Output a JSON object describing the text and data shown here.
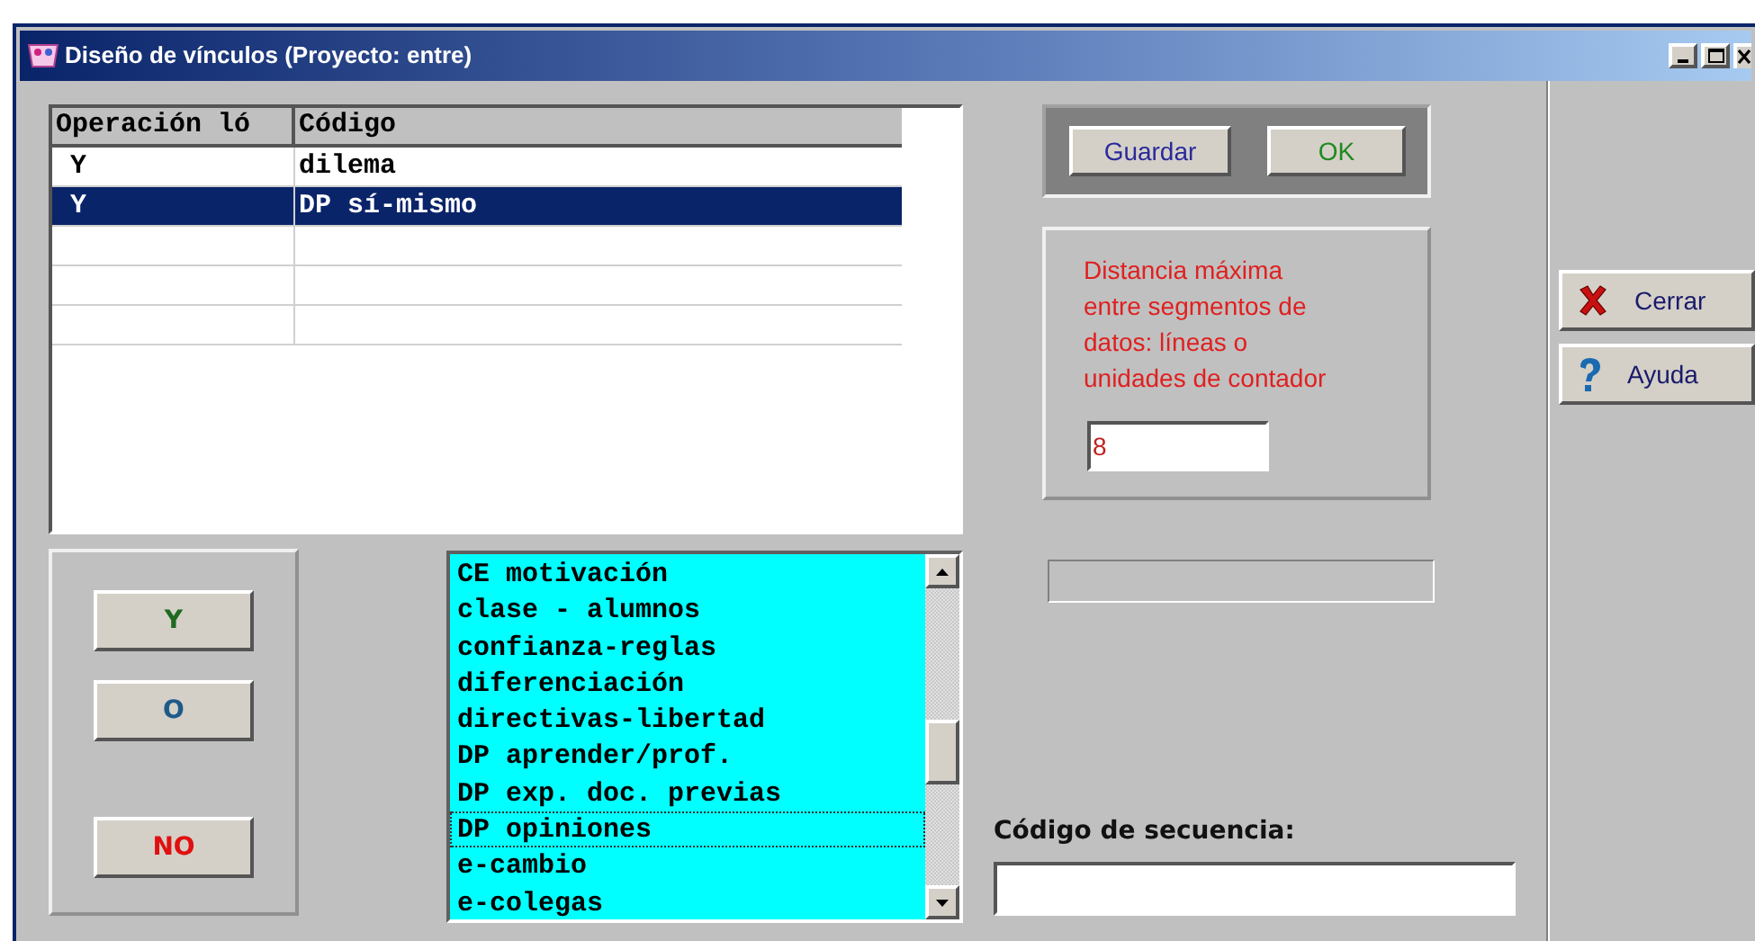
{
  "window": {
    "title": "Diseño de vínculos (Proyecto: entre)"
  },
  "table": {
    "columns": [
      "Operación ló",
      "Código"
    ],
    "rows": [
      {
        "cells": [
          "Y",
          "dilema"
        ],
        "selected": false
      },
      {
        "cells": [
          "Y",
          "DP sí-mismo"
        ],
        "selected": true
      },
      {
        "cells": [
          "",
          ""
        ],
        "selected": false
      },
      {
        "cells": [
          "",
          ""
        ],
        "selected": false
      },
      {
        "cells": [
          "",
          ""
        ],
        "selected": false
      }
    ]
  },
  "actions": [
    {
      "label": "Guardar",
      "color": "#2a2a9a"
    },
    {
      "label": "OK",
      "color": "#1e8a1e"
    }
  ],
  "distance": {
    "label_lines": [
      "Distancia máxima",
      "entre segmentos de",
      "datos: líneas o",
      "unidades de contador"
    ],
    "value": "8"
  },
  "side_buttons": [
    {
      "label": "Cerrar",
      "kind": "close"
    },
    {
      "label": "Ayuda",
      "kind": "help"
    }
  ],
  "operators": [
    {
      "label": "Y",
      "color": "#1e6a1e"
    },
    {
      "label": "O",
      "color": "#1e5a8a"
    },
    {
      "label": "NO",
      "color": "#e01010"
    }
  ],
  "codes": [
    {
      "label": "CE motivación",
      "focused": false
    },
    {
      "label": "clase - alumnos",
      "focused": false
    },
    {
      "label": "confianza-reglas",
      "focused": false
    },
    {
      "label": "diferenciación",
      "focused": false
    },
    {
      "label": "directivas-libertad",
      "focused": false
    },
    {
      "label": "DP aprender/prof.",
      "focused": false
    },
    {
      "label": "DP exp. doc. previas",
      "focused": false
    },
    {
      "label": "DP opiniones",
      "focused": true
    },
    {
      "label": "e-cambio",
      "focused": false
    },
    {
      "label": "e-colegas",
      "focused": false
    }
  ],
  "sequence": {
    "label": "Código de secuencia:"
  }
}
